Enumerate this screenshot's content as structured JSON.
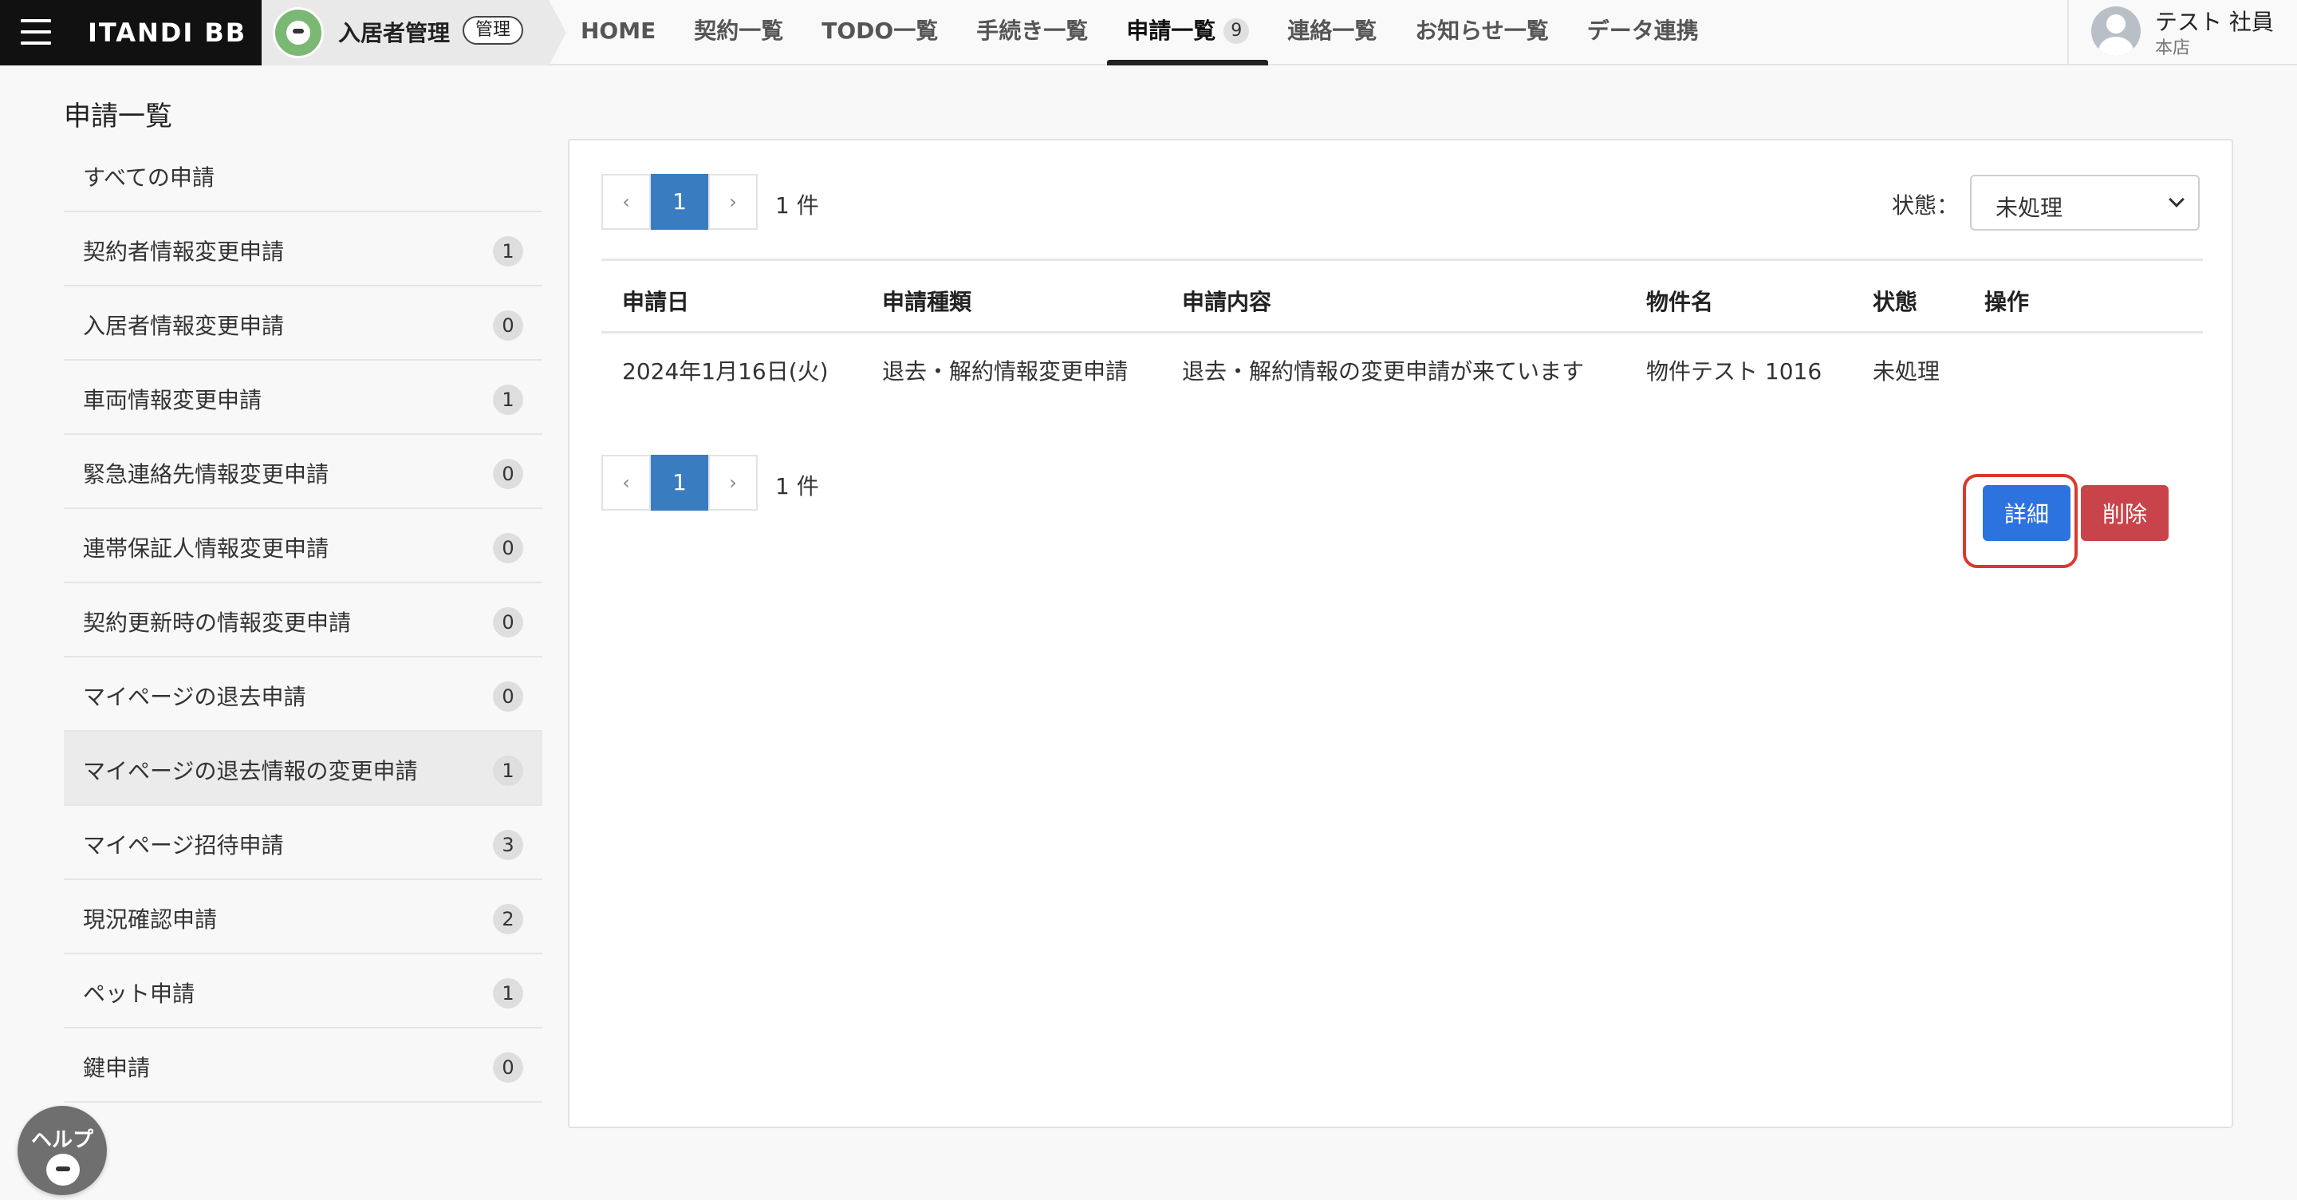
{
  "header": {
    "brand": "ITANDI BB",
    "app_name": "入居者管理",
    "admin_badge": "管理",
    "nav": [
      {
        "label": "HOME"
      },
      {
        "label": "契約一覧"
      },
      {
        "label": "TODO一覧"
      },
      {
        "label": "手続き一覧"
      },
      {
        "label": "申請一覧",
        "count": "9",
        "active": true
      },
      {
        "label": "連絡一覧"
      },
      {
        "label": "お知らせ一覧"
      },
      {
        "label": "データ連携"
      }
    ],
    "user": {
      "name": "テスト 社員",
      "branch": "本店"
    }
  },
  "page": {
    "title": "申請一覧"
  },
  "sidebar": {
    "items": [
      {
        "label": "すべての申請",
        "count": ""
      },
      {
        "label": "契約者情報変更申請",
        "count": "1"
      },
      {
        "label": "入居者情報変更申請",
        "count": "0"
      },
      {
        "label": "車両情報変更申請",
        "count": "1"
      },
      {
        "label": "緊急連絡先情報変更申請",
        "count": "0"
      },
      {
        "label": "連帯保証人情報変更申請",
        "count": "0"
      },
      {
        "label": "契約更新時の情報変更申請",
        "count": "0"
      },
      {
        "label": "マイページの退去申請",
        "count": "0"
      },
      {
        "label": "マイページの退去情報の変更申請",
        "count": "1",
        "selected": true
      },
      {
        "label": "マイページ招待申請",
        "count": "3"
      },
      {
        "label": "現況確認申請",
        "count": "2"
      },
      {
        "label": "ペット申請",
        "count": "1"
      },
      {
        "label": "鍵申請",
        "count": "0"
      }
    ]
  },
  "pager": {
    "prev": "‹",
    "current": "1",
    "next": "›",
    "total": "1 件"
  },
  "filter": {
    "label": "状態：",
    "value": "未処理"
  },
  "table": {
    "headers": {
      "date": "申請日",
      "type": "申請種類",
      "content": "申請内容",
      "property": "物件名",
      "status": "状態",
      "actions": "操作"
    },
    "rows": [
      {
        "date": "2024年1月16日(火)",
        "type": "退去・解約情報変更申請",
        "content": "退去・解約情報の変更申請が来ています",
        "property": "物件テスト 1016",
        "status": "未処理"
      }
    ]
  },
  "actions": {
    "detail": "詳細",
    "delete": "削除"
  },
  "help": {
    "label": "ヘルプ"
  },
  "colors": {
    "primary": "#2d73e0",
    "danger": "#c9434a",
    "pager_active": "#3a7cc0",
    "highlight": "#d93a2e"
  }
}
